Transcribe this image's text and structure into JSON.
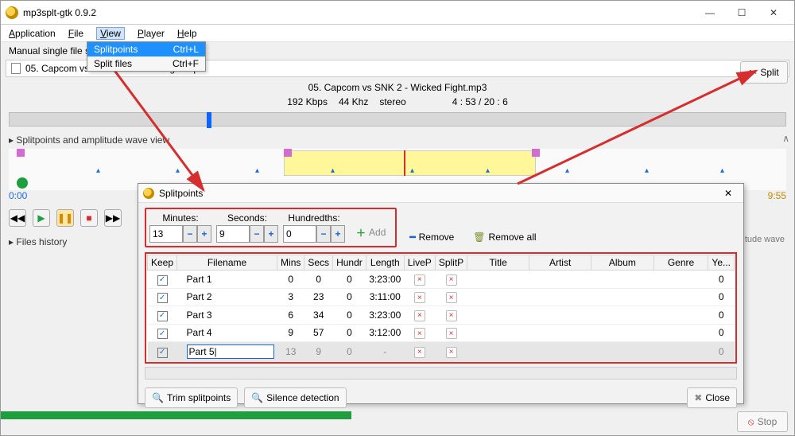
{
  "window": {
    "title": "mp3splt-gtk 0.9.2"
  },
  "menubar": {
    "app": "Application",
    "file": "File",
    "view": "View",
    "player": "Player",
    "help": "Help"
  },
  "viewmenu": {
    "splitpoints": "Splitpoints",
    "splitpoints_acc": "Ctrl+L",
    "splitfiles": "Split files",
    "splitfiles_acc": "Ctrl+F"
  },
  "toolbar": {
    "manual_label": "Manual single file s"
  },
  "splitbtn": {
    "label": "Split"
  },
  "file": {
    "name_line": "05. Capcom vs SNK 2 - Wicked Fight.mp3",
    "name": "05. Capcom vs SNK 2 - Wicked Fight.mp3"
  },
  "audio": {
    "bitrate": "192 Kbps",
    "freq": "44 Khz",
    "channels": "stereo",
    "time": "4 : 53  /  20 : 6"
  },
  "sections": {
    "wave": "Splitpoints and amplitude wave view",
    "history": "Files history"
  },
  "timeline": {
    "left": "0:00",
    "right": "9:55"
  },
  "amplitude_hint": "tude wave",
  "collapse": "∧",
  "dialog": {
    "title": "Splitpoints",
    "labels": {
      "minutes": "Minutes:",
      "seconds": "Seconds:",
      "hundr": "Hundredths:"
    },
    "values": {
      "minutes": "13",
      "seconds": "9",
      "hundr": "0"
    },
    "buttons": {
      "add": "Add",
      "remove": "Remove",
      "remove_all": "Remove all",
      "trim": "Trim splitpoints",
      "silence": "Silence detection",
      "close": "Close"
    },
    "headers": {
      "keep": "Keep",
      "filename": "Filename",
      "mins": "Mins",
      "secs": "Secs",
      "hundr": "Hundr",
      "length": "Length",
      "livep": "LiveP",
      "splitp": "SplitP",
      "title": "Title",
      "artist": "Artist",
      "album": "Album",
      "genre": "Genre",
      "year": "Ye..."
    },
    "rows": [
      {
        "keep": true,
        "filename": "Part 1",
        "mins": "0",
        "secs": "0",
        "hundr": "0",
        "length": "3:23:00",
        "year": "0"
      },
      {
        "keep": true,
        "filename": "Part 2",
        "mins": "3",
        "secs": "23",
        "hundr": "0",
        "length": "3:11:00",
        "year": "0"
      },
      {
        "keep": true,
        "filename": "Part 3",
        "mins": "6",
        "secs": "34",
        "hundr": "0",
        "length": "3:23:00",
        "year": "0"
      },
      {
        "keep": true,
        "filename": "Part 4",
        "mins": "9",
        "secs": "57",
        "hundr": "0",
        "length": "3:12:00",
        "year": "0"
      },
      {
        "keep": true,
        "filename": "Part 5",
        "mins": "13",
        "secs": "9",
        "hundr": "0",
        "length": "-",
        "year": "0",
        "editing": true
      }
    ]
  },
  "footer": {
    "stop": "Stop"
  }
}
